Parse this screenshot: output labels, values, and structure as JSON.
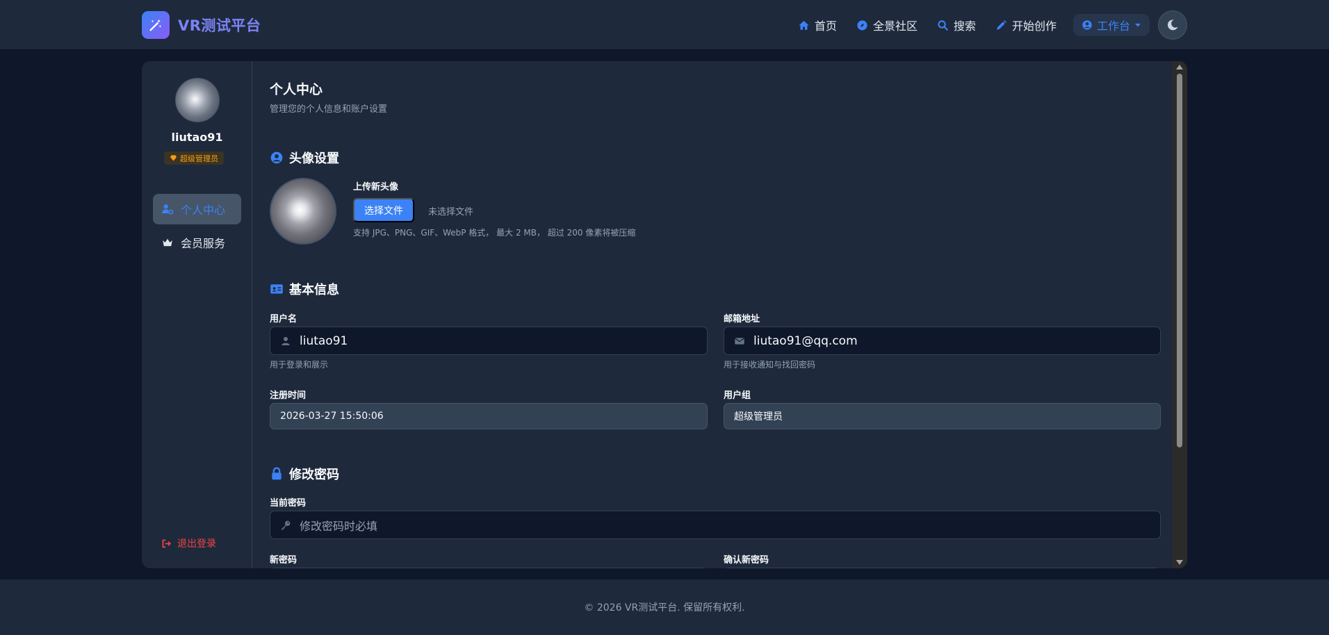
{
  "brand": {
    "name": "VR测试平台"
  },
  "nav": {
    "home": "首页",
    "community": "全景社区",
    "search": "搜索",
    "create": "开始创作",
    "workspace": "工作台"
  },
  "sidebar": {
    "username": "liutao91",
    "role": "超级管理员",
    "items": [
      {
        "label": "个人中心"
      },
      {
        "label": "会员服务"
      }
    ],
    "logout": "退出登录"
  },
  "page": {
    "title": "个人中心",
    "subtitle": "管理您的个人信息和账户设置"
  },
  "avatar_section": {
    "title": "头像设置",
    "upload_label": "上传新头像",
    "choose_file": "选择文件",
    "no_file": "未选择文件",
    "hint": "支持 JPG、PNG、GIF、WebP 格式， 最大 2 MB， 超过 200 像素将被压缩"
  },
  "basic_info": {
    "title": "基本信息",
    "username_label": "用户名",
    "username_value": "liutao91",
    "username_hint": "用于登录和展示",
    "email_label": "邮箱地址",
    "email_value": "liutao91@qq.com",
    "email_hint": "用于接收通知与找回密码",
    "register_label": "注册时间",
    "register_value": "2026-03-27 15:50:06",
    "group_label": "用户组",
    "group_value": "超级管理员"
  },
  "password": {
    "title": "修改密码",
    "current_label": "当前密码",
    "current_placeholder": "修改密码时必填",
    "new_label": "新密码",
    "confirm_label": "确认新密码"
  },
  "footer": {
    "text": "© 2026 VR测试平台. 保留所有权利."
  },
  "colors": {
    "accent": "#3b82f6",
    "brand_text": "#7c83f5",
    "background": "#0f172a",
    "surface": "#1e293b",
    "danger": "#ef4444",
    "badge": "#f59e0b"
  }
}
